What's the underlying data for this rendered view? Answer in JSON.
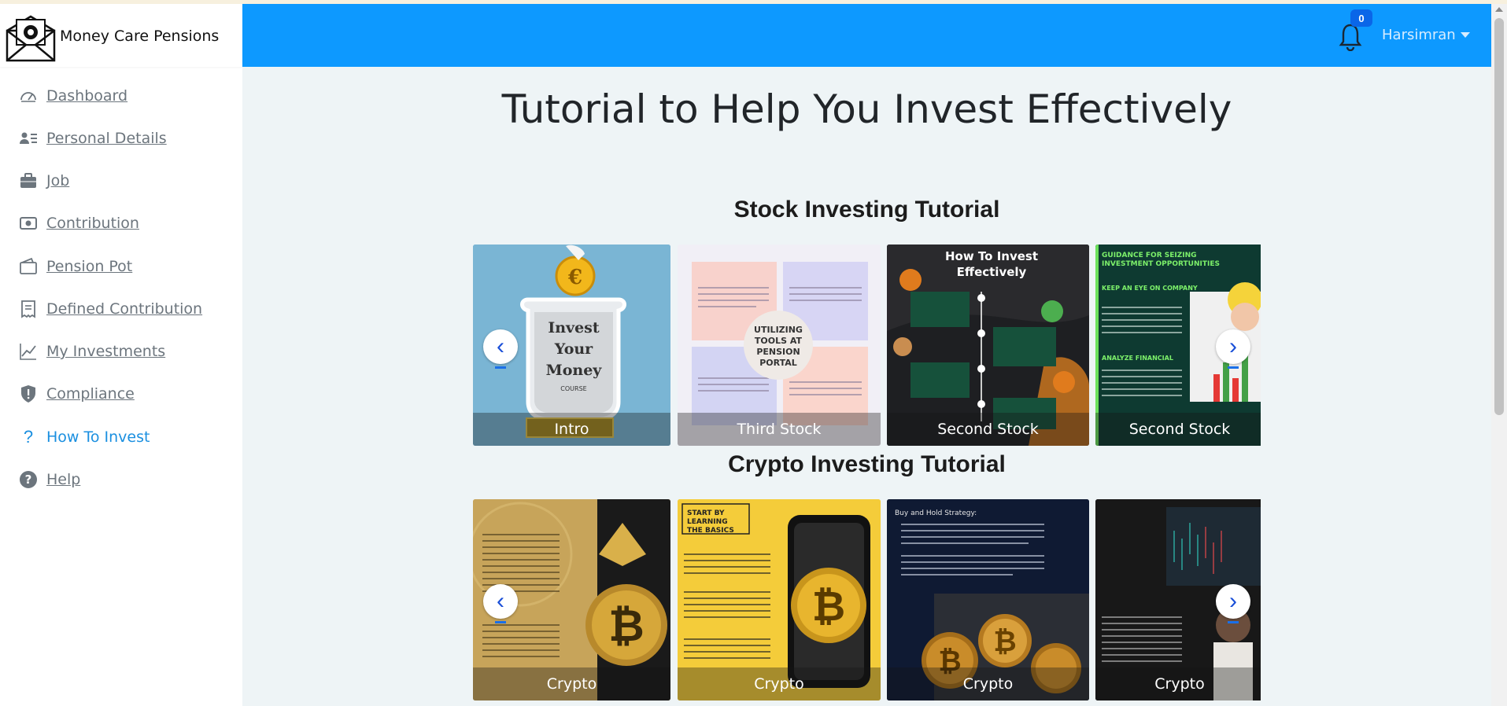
{
  "brand": {
    "name": "Money Care Pensions",
    "logo_icon": "envelope-logo-icon"
  },
  "sidebar": {
    "items": [
      {
        "label": "Dashboard",
        "icon": "speedometer-icon"
      },
      {
        "label": "Personal Details",
        "icon": "person-lines-icon"
      },
      {
        "label": "Job",
        "icon": "briefcase-icon"
      },
      {
        "label": "Contribution",
        "icon": "cash-icon"
      },
      {
        "label": "Pension Pot",
        "icon": "wallet-icon"
      },
      {
        "label": "Defined Contribution",
        "icon": "receipt-icon"
      },
      {
        "label": "My Investments",
        "icon": "graph-up-icon"
      },
      {
        "label": "Compliance",
        "icon": "shield-exclamation-icon"
      },
      {
        "label": "How To Invest",
        "icon": "question-icon",
        "active": true
      },
      {
        "label": "Help",
        "icon": "question-circle-icon"
      }
    ]
  },
  "header": {
    "notifications_count": "0",
    "user_name": "Harsimran",
    "background": "#0d99ff"
  },
  "main": {
    "title": "Tutorial to Help You Invest Effectively",
    "stock_section": {
      "title": "Stock Investing Tutorial",
      "cards": [
        "Intro",
        "Third Stock",
        "Second Stock",
        "Second Stock"
      ],
      "prev_symbol": "‹",
      "next_symbol": "›"
    },
    "crypto_section": {
      "title": "Crypto Investing Tutorial",
      "cards": [
        "Crypto",
        "Crypto",
        "Crypto",
        "Crypto"
      ],
      "prev_symbol": "‹",
      "next_symbol": "›"
    },
    "card_texts": {
      "jar": [
        "Invest",
        "Your",
        "Money",
        "COURSE"
      ],
      "tools": [
        "UTILIZING",
        "TOOLS AT",
        "PENSION",
        "PORTAL"
      ],
      "how_to": [
        "How To Invest",
        "Effectively"
      ],
      "guidance": "GUIDANCE FOR SEIZING INVESTMENT OPPORTUNITIES",
      "start": "START BY LEARNING THE BASICS",
      "buy_hold": "Buy and Hold Strategy:"
    }
  },
  "colors": {
    "accent": "#0d99ff",
    "active_nav": "#1a8fe0",
    "nav_text": "#6c757d"
  }
}
